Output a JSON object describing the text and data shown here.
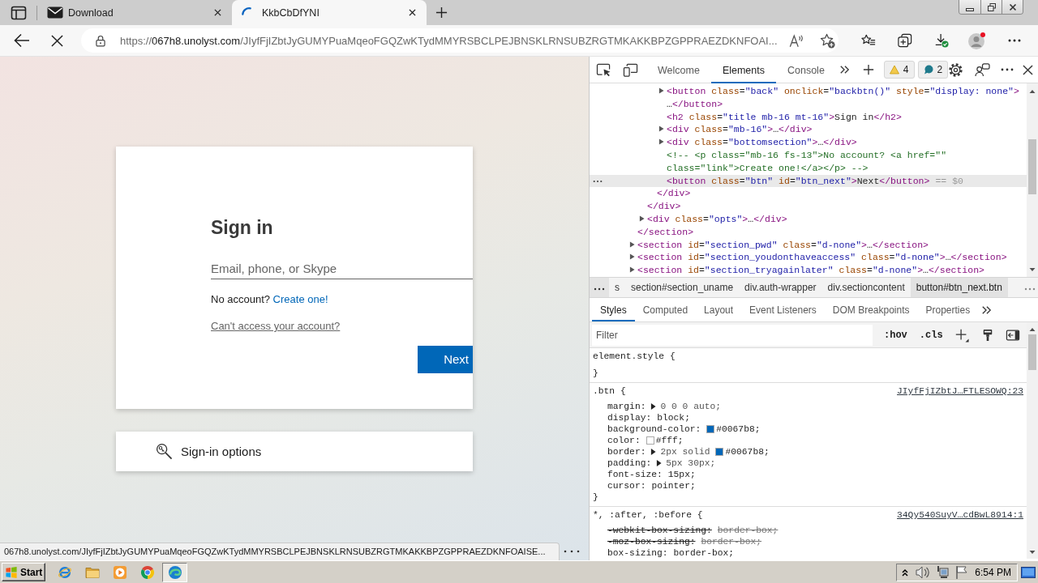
{
  "browser": {
    "tabs": [
      {
        "title": "Download",
        "selected": false,
        "loading": false
      },
      {
        "title": "KkbCbDfYNI",
        "selected": true,
        "loading": true
      }
    ],
    "address_bar": {
      "scheme": "https://",
      "host": "067h8.unolyst.com",
      "path": "/JIyfFjIZbtJyGUMYPuaMqeoFGQZwKTydMMYRSBCLPEJBNSKLRNSUBZRGTMKAKKBPZGPPRAEZDKNFOAI..."
    },
    "status_url": "067h8.unolyst.com/JIyfFjIZbtJyGUMYPuaMqeoFGQZwKTydMMYRSBCLPEJBNSKLRNSUBZRGTMKAKKBPZGPPRAEZDKNFOAISE..."
  },
  "page": {
    "sign_in": {
      "title": "Sign in",
      "email_placeholder": "Email, phone, or Skype",
      "no_account": "No account? ",
      "create_link": "Create one!",
      "cant_access": "Can't access your account?",
      "next_button": "Next"
    },
    "sign_in_options": "Sign-in options"
  },
  "devtools": {
    "tabs": [
      {
        "label": "Welcome",
        "selected": false
      },
      {
        "label": "Elements",
        "selected": true
      },
      {
        "label": "Console",
        "selected": false
      }
    ],
    "warning_count": "4",
    "message_count": "2",
    "dom_tree": [
      {
        "kind": "element",
        "selected": false,
        "close": "</section>",
        "children": [
          {
            "kind": "element",
            "selected": false,
            "close": "</div>",
            "children": [
              {
                "kind": "element",
                "selected": false,
                "close": "</div>",
                "children": [
                  {
                    "kind": "element",
                    "selected": false,
                    "expanded": false,
                    "markup": "<button class=\"back\" onclick=\"backbtn()\" style=\"display: none\">",
                    "collapsed_end": "…</button>"
                  },
                  {
                    "kind": "element",
                    "selected": false,
                    "markup": "<h2 class=\"title mb-16 mt-16\">Sign in</h2>"
                  },
                  {
                    "kind": "element",
                    "selected": false,
                    "expanded": false,
                    "markup": "<div class=\"mb-16\">",
                    "collapsed_end": "…</div>"
                  },
                  {
                    "kind": "element",
                    "selected": false,
                    "expanded": false,
                    "markup": "<div class=\"bottomsection\">",
                    "collapsed_end": "…</div>"
                  },
                  {
                    "kind": "comment",
                    "selected": false,
                    "markup": "<!-- <p class=\"mb-16 fs-13\">No account? <a href=\"\" class=\"link\">Create one!</a></p> -->"
                  },
                  {
                    "kind": "element",
                    "selected": true,
                    "markup": "<button class=\"btn\" id=\"btn_next\">Next</button>"
                  }
                ]
              }
            ]
          },
          {
            "kind": "element",
            "selected": false,
            "expanded": false,
            "markup": "<div class=\"opts\">",
            "collapsed_end": "…</div>"
          }
        ]
      },
      {
        "kind": "element",
        "selected": false,
        "expanded": false,
        "markup": "<section id=\"section_pwd\" class=\"d-none\">",
        "collapsed_end": "…</section>"
      },
      {
        "kind": "element",
        "selected": false,
        "expanded": false,
        "markup": "<section id=\"section_youdonthaveaccess\" class=\"d-none\">",
        "collapsed_end": "…</section>"
      },
      {
        "kind": "element",
        "selected": false,
        "expanded": false,
        "markup": "<section id=\"section_tryagainlater\" class=\"d-none\">",
        "collapsed_end": "…</section>"
      }
    ],
    "selected_suffix": "== $0",
    "breadcrumbs": [
      {
        "label": "s",
        "selected": false
      },
      {
        "label": "section#section_uname",
        "selected": false
      },
      {
        "label": "div.auth-wrapper",
        "selected": false
      },
      {
        "label": "div.sectioncontent",
        "selected": false
      },
      {
        "label": "button#btn_next.btn",
        "selected": true
      }
    ],
    "sidebar_tabs": [
      {
        "label": "Styles",
        "selected": true
      },
      {
        "label": "Computed",
        "selected": false
      },
      {
        "label": "Layout",
        "selected": false
      },
      {
        "label": "Event Listeners",
        "selected": false
      },
      {
        "label": "DOM Breakpoints",
        "selected": false
      },
      {
        "label": "Properties",
        "selected": false
      }
    ],
    "filter_placeholder": "Filter",
    "filter_toggles": [
      ":hov",
      ".cls"
    ],
    "rules": [
      {
        "selector": "element.style {",
        "close": "}"
      },
      {
        "selector": ".btn {",
        "source": "JIyfFjIZbtJ…FTLESOWQ:23",
        "close": "}",
        "declarations": [
          {
            "property": "margin:",
            "value": "0 0 0 auto;",
            "shorthand": true,
            "overridden": false
          },
          {
            "property": "display:",
            "value": "block;",
            "shorthand": false,
            "overridden": false
          },
          {
            "property": "background-color:",
            "color": "#0067b8",
            "color_value": "#0067b8;",
            "shorthand": false,
            "overridden": false
          },
          {
            "property": "color:",
            "color": "#ffffff",
            "color_value": "#fff;",
            "shorthand": false,
            "overridden": false
          },
          {
            "property": "border:",
            "value": "2px solid",
            "color": "#0067b8",
            "color_value": "#0067b8;",
            "shorthand": true,
            "overridden": false
          },
          {
            "property": "padding:",
            "value": "5px 30px;",
            "shorthand": true,
            "overridden": false
          },
          {
            "property": "font-size:",
            "value": "15px;",
            "shorthand": false,
            "overridden": false
          },
          {
            "property": "cursor:",
            "value": "pointer;",
            "shorthand": false,
            "overridden": false
          }
        ]
      },
      {
        "selector": "*, :after, :before {",
        "source": "34Qy540SuyV…cdBwL8914:1",
        "declarations": [
          {
            "property": "-webkit-box-sizing:",
            "value": "border-box;",
            "shorthand": false,
            "overridden": true
          },
          {
            "property": "-moz-box-sizing:",
            "value": "border-box;",
            "shorthand": false,
            "overridden": true
          },
          {
            "property": "box-sizing:",
            "value": "border-box;",
            "shorthand": false,
            "overridden": false
          }
        ]
      }
    ]
  },
  "taskbar": {
    "start_label": "Start",
    "apps": [
      {
        "kind": "ie",
        "selected": false
      },
      {
        "kind": "explorer",
        "selected": false
      },
      {
        "kind": "media-player",
        "selected": false
      },
      {
        "kind": "chrome",
        "selected": false
      },
      {
        "kind": "edge",
        "selected": true
      }
    ],
    "clock": "6:54 PM"
  }
}
